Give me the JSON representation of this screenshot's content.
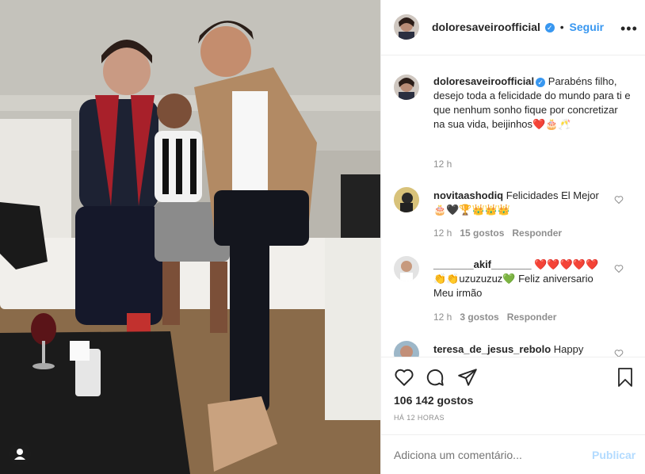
{
  "post": {
    "username": "doloresaveiroofficial",
    "separator": "•",
    "follow_label": "Seguir",
    "more_icon": "more-options-icon"
  },
  "caption": {
    "username": "doloresaveiroofficial",
    "text": "Parabéns filho, desejo toda a felicidade do mundo para ti e que nenhum sonho fique por concretizar na sua vida, beijinhos❤️🎂🥂",
    "time": "12 h"
  },
  "comments": [
    {
      "username": "novitaashodiq",
      "text": "Felicidades El Mejor 🎂🖤🏆👑👑👑",
      "time": "12 h",
      "likes": "15 gostos",
      "reply": "Responder"
    },
    {
      "username": "_______akif_______",
      "text": "❤️❤️❤️❤️❤️👏👏uzuzuzuz💚 Feliz aniversario Meu irmão",
      "time": "12 h",
      "likes": "3 gostos",
      "reply": "Responder"
    },
    {
      "username": "teresa_de_jesus_rebolo",
      "text": "Happy"
    }
  ],
  "stats": {
    "likes": "106 142 gostos",
    "date": "HÁ 12 HORAS"
  },
  "composer": {
    "placeholder": "Adiciona um comentário...",
    "publish_label": "Publicar"
  },
  "colors": {
    "link_blue": "#3897f0",
    "publish_disabled": "#b3dbff",
    "meta_gray": "#8e8e8e",
    "heart_red": "#ed1c24"
  }
}
